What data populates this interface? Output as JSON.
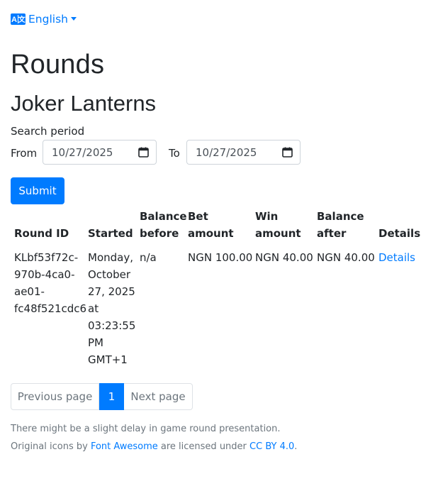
{
  "language": {
    "label": "English",
    "icon": "translate-icon"
  },
  "page": {
    "title": "Rounds",
    "game_name": "Joker Lanterns"
  },
  "search": {
    "label": "Search period",
    "from_label": "From",
    "to_label": "To",
    "from_value": "10/27/2025",
    "to_value": "10/27/2025",
    "submit_label": "Submit"
  },
  "table": {
    "headers": {
      "round_id": "Round ID",
      "started": "Started",
      "balance_before_1": "Balance",
      "balance_before_2": "before",
      "bet_1": "Bet",
      "bet_2": "amount",
      "win_1": "Win",
      "win_2": "amount",
      "balance_after_1": "Balance",
      "balance_after_2": "after",
      "details": "Details"
    },
    "rows": [
      {
        "round_id_lines": [
          "KLbf53f72c-",
          "970b-4ca0-",
          "ae01-",
          "fc48f521cdc6"
        ],
        "started_lines": [
          "Monday,",
          "October",
          "27, 2025",
          "at",
          "03:23:55",
          "PM",
          "GMT+1"
        ],
        "balance_before": "n/a",
        "bet_amount": "NGN 100.00",
        "win_amount": "NGN 40.00",
        "balance_after": "NGN 40.00",
        "details_link": "Details"
      }
    ]
  },
  "pagination": {
    "previous": "Previous page",
    "current": "1",
    "next": "Next page"
  },
  "footer": {
    "delay_note": "There might be a slight delay in game round presentation.",
    "icons_prefix": "Original icons by ",
    "icons_link": "Font Awesome",
    "icons_middle": " are licensed under ",
    "license_link": "CC BY 4.0",
    "icons_suffix": "."
  },
  "colors": {
    "accent": "#007bff",
    "text": "#212529",
    "muted": "#6c757d",
    "border": "#ced4da"
  }
}
